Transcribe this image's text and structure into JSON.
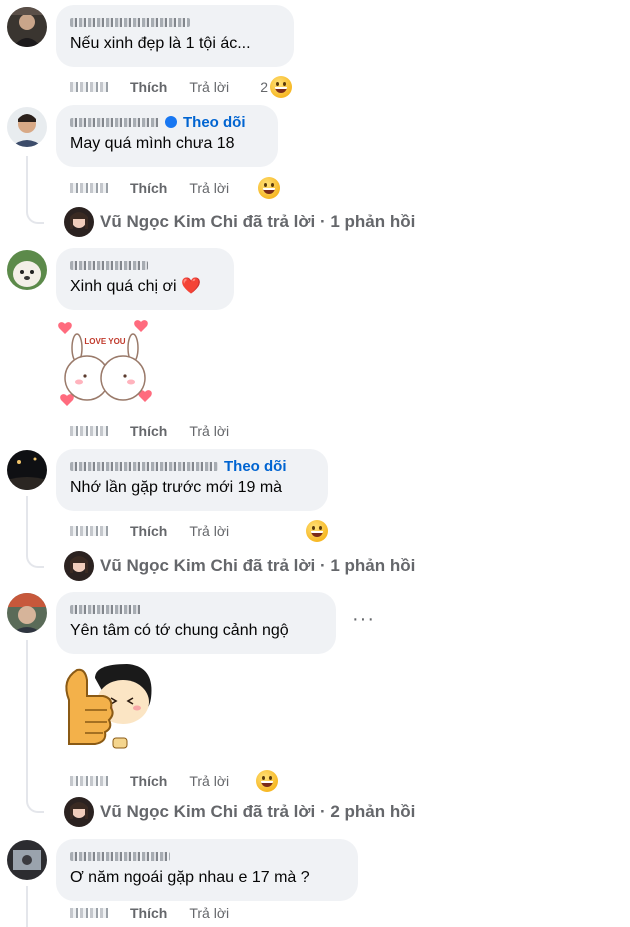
{
  "actions": {
    "like": "Thích",
    "reply": "Trả lời",
    "follow": "Theo dõi",
    "more": "···"
  },
  "comments": [
    {
      "text": "Nếu xinh đẹp là 1 tội ác...",
      "reaction_count": "2"
    },
    {
      "text": "May quá mình chưa 18",
      "reply_summary": {
        "author": "Vũ Ngọc Kim Chi",
        "label": "đã trả lời",
        "separator": "·",
        "count": "1 phản hồi"
      }
    },
    {
      "text": "Xinh quá chị ơi ❤️",
      "sticker_text": "LOVE YOU"
    },
    {
      "text": "Nhớ lần gặp trước mới 19 mà",
      "reply_summary": {
        "author": "Vũ Ngọc Kim Chi",
        "label": "đã trả lời",
        "separator": "·",
        "count": "1 phản hồi"
      }
    },
    {
      "text": "Yên tâm có tớ chung cảnh ngộ",
      "reply_summary": {
        "author": "Vũ Ngọc Kim Chi",
        "label": "đã trả lời",
        "separator": "·",
        "count": "2 phản hồi"
      }
    },
    {
      "text": "Ơ năm ngoái gặp nhau e 17 mà ?"
    }
  ]
}
